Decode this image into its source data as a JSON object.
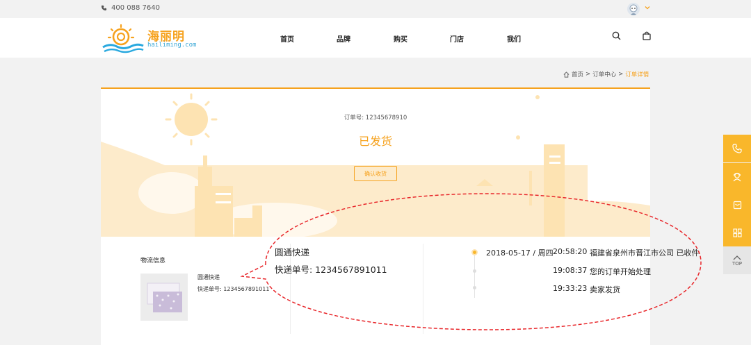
{
  "topbar": {
    "phone": "400 088 7640"
  },
  "logo": {
    "cn": "海丽明",
    "en": "hailiming.com"
  },
  "nav": [
    "首页",
    "品牌",
    "购买",
    "门店",
    "我们"
  ],
  "breadcrumb": {
    "home": "首页",
    "center": "订单中心",
    "current": "订单详情",
    "sep": ">"
  },
  "order": {
    "number_label": "订单号: 12345678910",
    "status": "已发货",
    "confirm_label": "确认收货"
  },
  "logistics": {
    "title": "物流信息",
    "company": "圆通快递",
    "tracking_small": "快递单号: 1234567891011",
    "tracking_big": "快递单号: 1234567891011",
    "timeline": [
      {
        "date": "2018-05-17 / 周四",
        "time": "20:58:20",
        "desc": "福建省泉州市晋江市公司 已收件"
      },
      {
        "date": "",
        "time": "19:08:37",
        "desc": "您的订单开始处理"
      },
      {
        "date": "",
        "time": "19:33:23",
        "desc": "卖家发货"
      }
    ]
  },
  "sidebar": {
    "top_label": "TOP"
  },
  "colors": {
    "accent": "#f6a21e",
    "sidebar": "#f9b72b",
    "annotation": "#e8262a"
  },
  "icons": [
    "phone-icon",
    "user-avatar",
    "chevron-down-icon",
    "search-icon",
    "bag-icon",
    "home-icon",
    "customer-service-icon",
    "message-icon",
    "grid-icon",
    "arrow-up-icon"
  ]
}
